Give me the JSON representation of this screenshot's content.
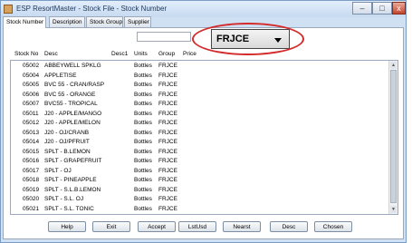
{
  "window": {
    "title": "ESP ResortMaster - Stock File - Stock Number",
    "min_label": "–",
    "max_label": "□",
    "close_label": "x"
  },
  "tabs": [
    {
      "label": "Stock Number"
    },
    {
      "label": "Description"
    },
    {
      "label": "Stock Group"
    },
    {
      "label": "Supplier"
    }
  ],
  "search": {
    "value": ""
  },
  "group_select": {
    "value": "FRJCE"
  },
  "columns": [
    "Stock No",
    "Desc",
    "Desc1",
    "Units",
    "Group",
    "Price"
  ],
  "rows": [
    {
      "stock": "05002",
      "desc": "ABBEYWELL SPKLG",
      "units": "Bottles",
      "group": "FRJCE"
    },
    {
      "stock": "05004",
      "desc": "APPLETISE",
      "units": "Bottles",
      "group": "FRJCE"
    },
    {
      "stock": "05005",
      "desc": "BVC 55 - CRAN/RASP",
      "units": "Bottles",
      "group": "FRJCE"
    },
    {
      "stock": "05006",
      "desc": "BVC 55 - ORANGE",
      "units": "Bottles",
      "group": "FRJCE"
    },
    {
      "stock": "05007",
      "desc": "BVC55 - TROPICAL",
      "units": "Bottles",
      "group": "FRJCE"
    },
    {
      "stock": "05011",
      "desc": "J20 - APPLE/MANGO",
      "units": "Bottles",
      "group": "FRJCE"
    },
    {
      "stock": "05012",
      "desc": "J20 - APPLE/MELON",
      "units": "Bottles",
      "group": "FRJCE"
    },
    {
      "stock": "05013",
      "desc": "J20 - OJ/CRANB",
      "units": "Bottles",
      "group": "FRJCE"
    },
    {
      "stock": "05014",
      "desc": "J20 - OJ/PFRUIT",
      "units": "Bottles",
      "group": "FRJCE"
    },
    {
      "stock": "05015",
      "desc": "SPLT - B.LEMON",
      "units": "Bottles",
      "group": "FRJCE"
    },
    {
      "stock": "05016",
      "desc": "SPLT - GRAPEFRUIT",
      "units": "Bottles",
      "group": "FRJCE"
    },
    {
      "stock": "05017",
      "desc": "SPLT - OJ",
      "units": "Bottles",
      "group": "FRJCE"
    },
    {
      "stock": "05018",
      "desc": "SPLT - PINEAPPLE",
      "units": "Bottles",
      "group": "FRJCE"
    },
    {
      "stock": "05019",
      "desc": "SPLT - S.L.B.LEMON",
      "units": "Bottles",
      "group": "FRJCE"
    },
    {
      "stock": "05020",
      "desc": "SPLT - S.L. OJ",
      "units": "Bottles",
      "group": "FRJCE"
    },
    {
      "stock": "05021",
      "desc": "SPLT - S.L. TONIC",
      "units": "Bottles",
      "group": "FRJCE"
    }
  ],
  "buttons": [
    "Help",
    "Exit",
    "Accept",
    "LstUsd",
    "Nearst",
    "Desc",
    "Chosen"
  ],
  "colors": {
    "highlight": "#d32b2b",
    "window_frame": "#cfe0f3"
  }
}
